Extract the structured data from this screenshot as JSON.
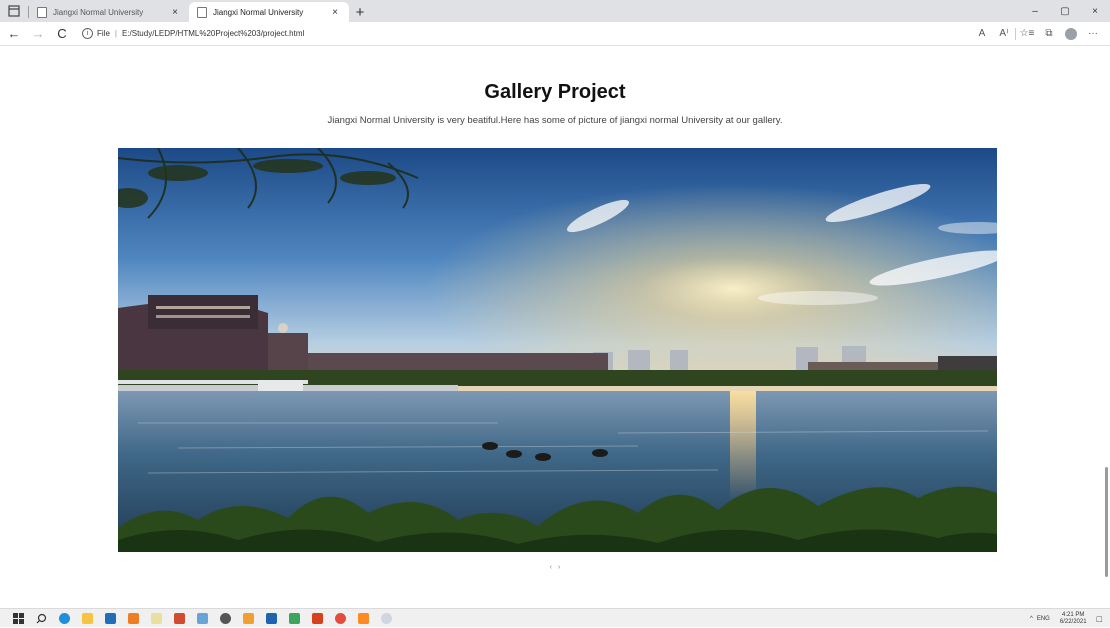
{
  "browser": {
    "tabs": [
      {
        "title": "Jiangxi Normal University",
        "active": false,
        "close": "×"
      },
      {
        "title": "Jiangxi Normal University",
        "active": true,
        "close": "×"
      }
    ],
    "new_tab": "+",
    "window_controls": {
      "minimize": "–",
      "maximize": "▢",
      "close": "×"
    },
    "nav": {
      "back": "←",
      "forward": "→",
      "reload": "C"
    },
    "address": {
      "info": "i",
      "scheme_label": "File",
      "separator": "|",
      "url": "E:/Study/LEDP/HTML%20Project%203/project.html"
    },
    "toolbar_icons": {
      "read_aloud": "A",
      "favorite": "☆",
      "favorites": "☆≡",
      "collections": "⧉",
      "more": "···",
      "read_mode": "A⁾"
    }
  },
  "page": {
    "title": "Gallery Project",
    "subtitle": "Jiangxi Normal University is very beatiful.Here has some of picture of jiangxi normal University at our gallery.",
    "carousel": {
      "prev": "‹",
      "next": "›"
    }
  },
  "taskbar": {
    "icons": [
      "windows-start-icon",
      "search-icon",
      "edge-icon",
      "file-explorer-icon",
      "mail-icon",
      "sublime-icon",
      "notepad-icon",
      "app-icon",
      "paint-icon",
      "settings-icon",
      "office-icon",
      "outlook-icon",
      "app-green-icon",
      "office-red-icon",
      "chrome-icon",
      "app-orange-icon",
      "app-cloud-icon"
    ],
    "tray": {
      "chevron": "^",
      "language": "ENG",
      "time": "4:21 PM",
      "date": "6/22/2021",
      "notifications": "□"
    }
  },
  "colors": {
    "tabstrip": "#dfe1e5",
    "sky_top": "#1f4f8d",
    "sky_low": "#8fb6dd",
    "sun": "#ffd27a",
    "water": "#355e80",
    "foliage": "#2d4d1f"
  }
}
